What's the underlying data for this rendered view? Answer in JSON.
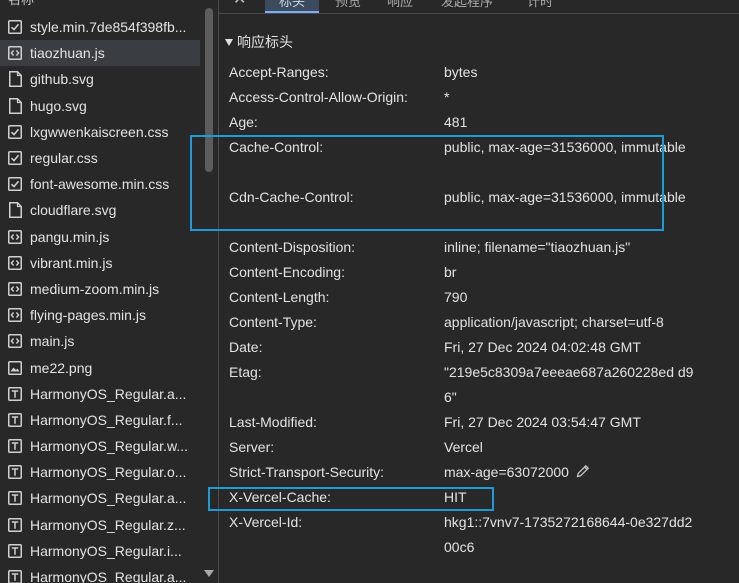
{
  "file_list": {
    "header": "名称",
    "items": [
      {
        "name": "style.min.7de854f398fb...",
        "icon": "css-icon"
      },
      {
        "name": "tiaozhuan.js",
        "icon": "script-icon",
        "selected": true
      },
      {
        "name": "github.svg",
        "icon": "image-file-icon"
      },
      {
        "name": "hugo.svg",
        "icon": "image-file-icon"
      },
      {
        "name": "lxgwwenkaiscreen.css",
        "icon": "css-icon"
      },
      {
        "name": "regular.css",
        "icon": "css-icon"
      },
      {
        "name": "font-awesome.min.css",
        "icon": "css-icon"
      },
      {
        "name": "cloudflare.svg",
        "icon": "image-file-icon"
      },
      {
        "name": "pangu.min.js",
        "icon": "script-icon"
      },
      {
        "name": "vibrant.min.js",
        "icon": "script-icon"
      },
      {
        "name": "medium-zoom.min.js",
        "icon": "script-icon"
      },
      {
        "name": "flying-pages.min.js",
        "icon": "script-icon"
      },
      {
        "name": "main.js",
        "icon": "script-icon"
      },
      {
        "name": "me22.png",
        "icon": "png-icon"
      },
      {
        "name": "HarmonyOS_Regular.a...",
        "icon": "font-icon"
      },
      {
        "name": "HarmonyOS_Regular.f...",
        "icon": "font-icon"
      },
      {
        "name": "HarmonyOS_Regular.w...",
        "icon": "font-icon"
      },
      {
        "name": "HarmonyOS_Regular.o...",
        "icon": "font-icon"
      },
      {
        "name": "HarmonyOS_Regular.a...",
        "icon": "font-icon"
      },
      {
        "name": "HarmonyOS_Regular.z...",
        "icon": "font-icon"
      },
      {
        "name": "HarmonyOS_Regular.i...",
        "icon": "font-icon"
      },
      {
        "name": "HarmonyOS_Regular.a...",
        "icon": "font-icon"
      }
    ]
  },
  "tabs": {
    "close": "✕",
    "items": [
      "标头",
      "预览",
      "响应",
      "发起程序",
      "计时"
    ],
    "active": "标头"
  },
  "response_headers": {
    "title": "响应标头",
    "rows": [
      {
        "name": "Accept-Ranges:",
        "value": "bytes"
      },
      {
        "name": "Access-Control-Allow-Origin:",
        "value": "*"
      },
      {
        "name": "Age:",
        "value": "481"
      },
      {
        "name": "Cache-Control:",
        "value": "public, max-age=31536000, immutable"
      },
      {
        "name": "Cdn-Cache-Control:",
        "value": "public, max-age=31536000, immutable"
      },
      {
        "name": "Content-Disposition:",
        "value": "inline; filename=\"tiaozhuan.js\""
      },
      {
        "name": "Content-Encoding:",
        "value": "br"
      },
      {
        "name": "Content-Length:",
        "value": "790"
      },
      {
        "name": "Content-Type:",
        "value": "application/javascript; charset=utf-8"
      },
      {
        "name": "Date:",
        "value": "Fri, 27 Dec 2024 04:02:48 GMT"
      },
      {
        "name": "Etag:",
        "value": "\"219e5c8309a7eeeae687a260228ed d96\""
      },
      {
        "name": "Last-Modified:",
        "value": "Fri, 27 Dec 2024 03:54:47 GMT"
      },
      {
        "name": "Server:",
        "value": "Vercel"
      },
      {
        "name": "Strict-Transport-Security:",
        "value": "max-age=63072000"
      },
      {
        "name": "X-Vercel-Cache:",
        "value": "HIT"
      },
      {
        "name": "X-Vercel-Id:",
        "value": "hkg1::7vnv7-1735272168644-0e327dd200c6"
      }
    ]
  },
  "colors": {
    "background": "#282828",
    "highlight_box": "#1e9ad6",
    "active_tab": "#3b4a5c"
  }
}
